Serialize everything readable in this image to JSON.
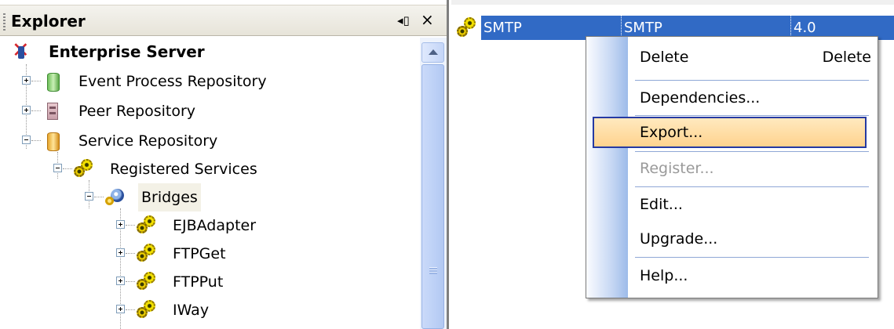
{
  "explorer": {
    "title": "Explorer",
    "pin_glyph": "◂▯",
    "close_glyph": "×",
    "tree": [
      {
        "label": "Enterprise Server",
        "icon": "enterprise-server-icon"
      },
      {
        "label": "Event Process Repository",
        "icon": "database-green-icon"
      },
      {
        "label": "Peer Repository",
        "icon": "peer-repository-icon"
      },
      {
        "label": "Service Repository",
        "icon": "database-yellow-icon"
      },
      {
        "label": "Registered Services",
        "icon": "gears-icon"
      },
      {
        "label": "Bridges",
        "icon": "bridge-icon"
      },
      {
        "label": "EJBAdapter",
        "icon": "gears-icon"
      },
      {
        "label": "FTPGet",
        "icon": "gears-icon"
      },
      {
        "label": "FTPPut",
        "icon": "gears-icon"
      },
      {
        "label": "IWay",
        "icon": "gears-icon"
      }
    ]
  },
  "table": {
    "selected_row": {
      "name": "SMTP",
      "type": "SMTP",
      "version": "4.0",
      "icon": "gears-icon"
    }
  },
  "context_menu": {
    "items": [
      {
        "label": "Delete",
        "shortcut": "Delete",
        "enabled": true
      },
      {
        "label": "Dependencies...",
        "enabled": true
      },
      {
        "label": "Export...",
        "enabled": true,
        "highlighted": true
      },
      {
        "label": "Register...",
        "enabled": false
      },
      {
        "label": "Edit...",
        "enabled": true
      },
      {
        "label": "Upgrade...",
        "enabled": true
      },
      {
        "label": "Help...",
        "enabled": true
      }
    ]
  },
  "colors": {
    "selection": "#316ac5",
    "menu_highlight": "#ffd38e",
    "menu_highlight_border": "#253aa3",
    "disabled_text": "#9a9a9a"
  }
}
